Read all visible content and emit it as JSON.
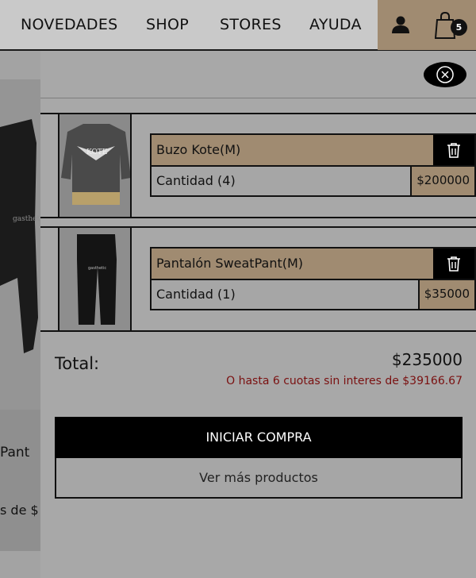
{
  "nav": {
    "links": [
      "NOVEDADES",
      "SHOP",
      "STORES",
      "AYUDA"
    ],
    "cart_count": "5",
    "accent_color": "#a08b71"
  },
  "background_page": {
    "product_name_fragment": "Pant",
    "price_fragment": "s de $"
  },
  "cart": {
    "items": [
      {
        "name": "Buzo Kote(M)",
        "quantity_label": "Cantidad (4)",
        "price": "$200000",
        "image": "washed-sweater"
      },
      {
        "name": "Pantalón SweatPant(M)",
        "quantity_label": "Cantidad (1)",
        "price": "$35000",
        "image": "black-sweatpants"
      }
    ],
    "total_label": "Total:",
    "total_value": "$235000",
    "installments_text": "O hasta 6 cuotas sin interes de $39166.67",
    "start_button_label": "INICIAR COMPRA",
    "more_products_label": "Ver más productos"
  }
}
